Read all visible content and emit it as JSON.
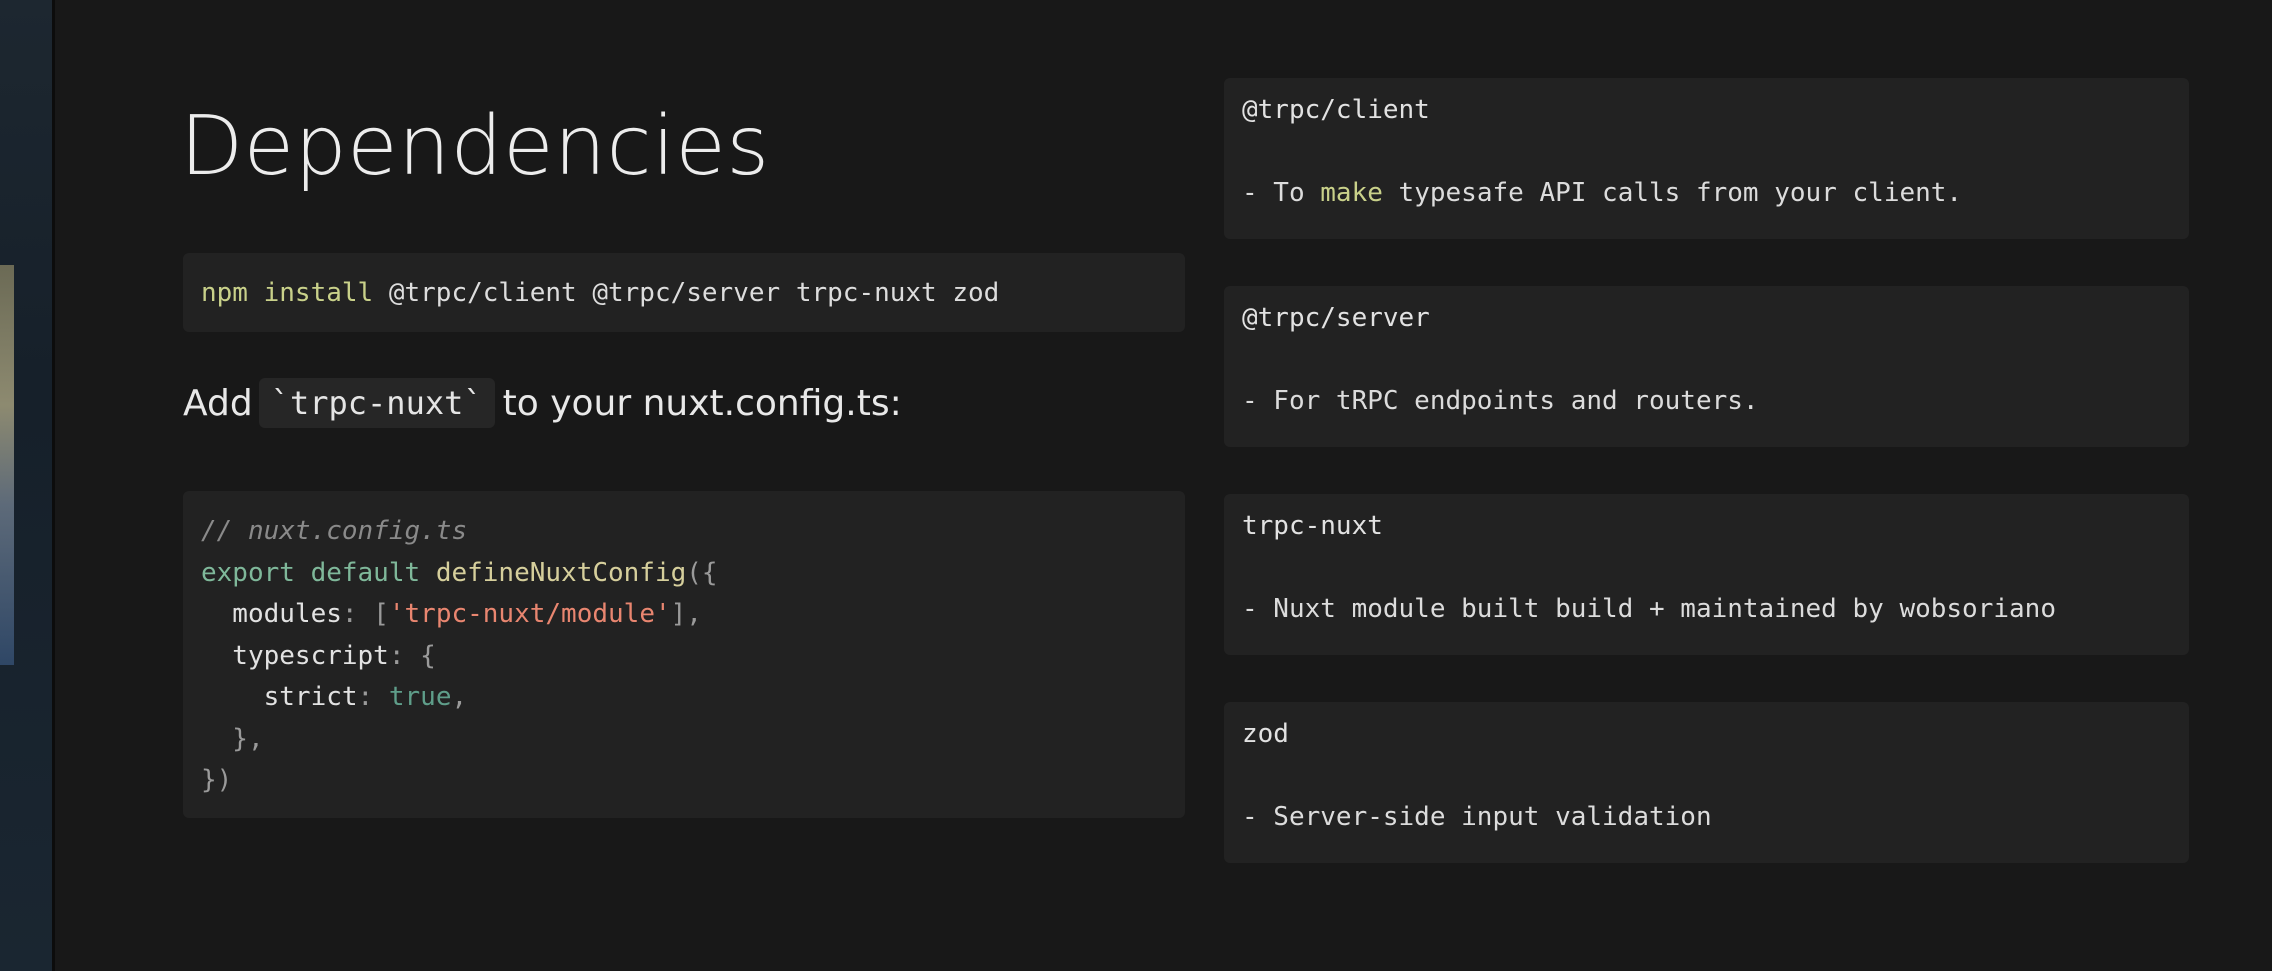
{
  "slide": {
    "title": "Dependencies",
    "install_command": {
      "keyword": "npm install",
      "args": " @trpc/client @trpc/server trpc-nuxt zod"
    },
    "add_line": {
      "prefix": "Add",
      "code": "`trpc-nuxt`",
      "suffix": "to your nuxt.config.ts:"
    },
    "code_block": {
      "comment": "// nuxt.config.ts",
      "line2": {
        "kw": "export default",
        "fn": "defineNuxtConfig",
        "punc": "({"
      },
      "line3": {
        "key": "  modules",
        "punc1": ": [",
        "str": "'trpc-nuxt/module'",
        "punc2": "],"
      },
      "line4": {
        "key": "  typescript",
        "punc": ": {"
      },
      "line5": {
        "key": "    strict",
        "punc1": ": ",
        "bool": "true",
        "punc2": ","
      },
      "line6": "  },",
      "line7": "})"
    }
  },
  "dependencies": [
    {
      "name": "@trpc/client",
      "desc_before": "- To ",
      "desc_highlight": "make",
      "desc_after": " typesafe API calls from your client."
    },
    {
      "name": "@trpc/server",
      "desc": "- For tRPC endpoints and routers."
    },
    {
      "name": "trpc-nuxt",
      "desc": "- Nuxt module built build + maintained by wobsoriano"
    },
    {
      "name": "zod",
      "desc": "- Server-side input validation"
    }
  ],
  "colors": {
    "background": "#181818",
    "card": "#222222",
    "keyword_green": "#7fb89a",
    "string_orange": "#e98670",
    "function_yellow": "#d6cf9c",
    "npm_yellow": "#c9d18a"
  }
}
